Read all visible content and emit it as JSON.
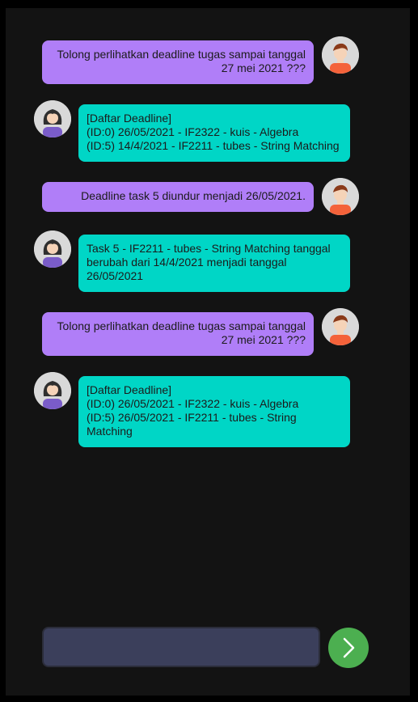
{
  "conversation": {
    "messages": [
      {
        "sender": "user",
        "avatar": "male-user-avatar-icon",
        "text": "Tolong perlihatkan deadline tugas sampai tanggal\n27 mei 2021 ???"
      },
      {
        "sender": "bot",
        "avatar": "female-bot-avatar-icon",
        "text": "[Daftar Deadline]\n(ID:0) 26/05/2021 - IF2322 - kuis - Algebra\n(ID:5) 14/4/2021 - IF2211 - tubes - String Matching"
      },
      {
        "sender": "user",
        "avatar": "male-user-avatar-icon",
        "text": "Deadline task 5 diundur menjadi 26/05/2021."
      },
      {
        "sender": "bot",
        "avatar": "female-bot-avatar-icon",
        "text": "Task 5 - IF2211 - tubes - String Matching tanggal\nberubah dari 14/4/2021 menjadi tanggal\n26/05/2021"
      },
      {
        "sender": "user",
        "avatar": "male-user-avatar-icon",
        "text": "Tolong perlihatkan deadline tugas sampai tanggal\n27 mei 2021 ???"
      },
      {
        "sender": "bot",
        "avatar": "female-bot-avatar-icon",
        "text": "[Daftar Deadline]\n(ID:0) 26/05/2021 - IF2322 - kuis - Algebra\n(ID:5) 26/05/2021 - IF2211 - tubes - String\nMatching"
      }
    ]
  },
  "composer": {
    "input_value": "",
    "input_placeholder": "",
    "send_icon": "chevron-right-icon"
  },
  "colors": {
    "background": "#131313",
    "user_bubble": "#b07ef8",
    "bot_bubble": "#00d6c6",
    "input": "#3b3f5b",
    "send_button": "#4caf50"
  }
}
